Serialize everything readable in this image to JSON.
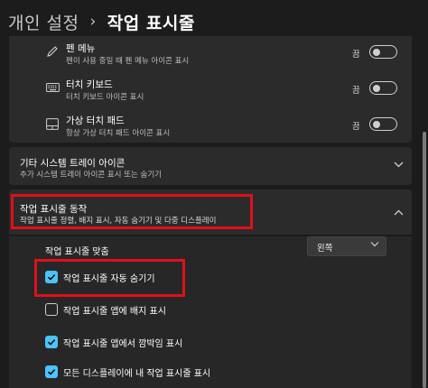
{
  "header": {
    "parent": "개인 설정",
    "separator": "›",
    "current": "작업 표시줄"
  },
  "corner_icons": [
    {
      "title": "펜 메뉴",
      "subtitle": "펜이 사용 중일 때 펜 메뉴 아이콘 표시",
      "state": "끔",
      "icon": "pen-icon",
      "toggle_on": false
    },
    {
      "title": "터치 키보드",
      "subtitle": "터치 키보드 아이콘 표시",
      "state": "끔",
      "icon": "keyboard-icon",
      "toggle_on": false
    },
    {
      "title": "가상 터치 패드",
      "subtitle": "항상 가상 터치 패드 아이콘 표시",
      "state": "끔",
      "icon": "touchpad-icon",
      "toggle_on": false
    }
  ],
  "other_tray": {
    "title": "기타 시스템 트레이 아이콘",
    "subtitle": "추가 시스템 트레이 아이콘 표시 또는 숨기기"
  },
  "behaviors": {
    "title": "작업 표시줄 동작",
    "subtitle": "작업 표시줄 정렬, 배지 표시, 자동 숨기기 및 다중 디스플레이",
    "alignment_label": "작업 표시줄 맞춤",
    "alignment_value": "왼쪽",
    "options": [
      {
        "label": "작업 표시줄 자동 숨기기",
        "checked": true
      },
      {
        "label": "작업 표시줄 앱에 배지 표시",
        "checked": false
      },
      {
        "label": "작업 표시줄 앱에서 깜박임 표시",
        "checked": true
      },
      {
        "label": "모든 디스플레이에 내 작업 표시줄 표시",
        "checked": true
      }
    ]
  },
  "colors": {
    "accent": "#4cc2ff",
    "highlight": "#e0101a",
    "background": "#1c1c1c",
    "card": "#2b2b2b"
  }
}
